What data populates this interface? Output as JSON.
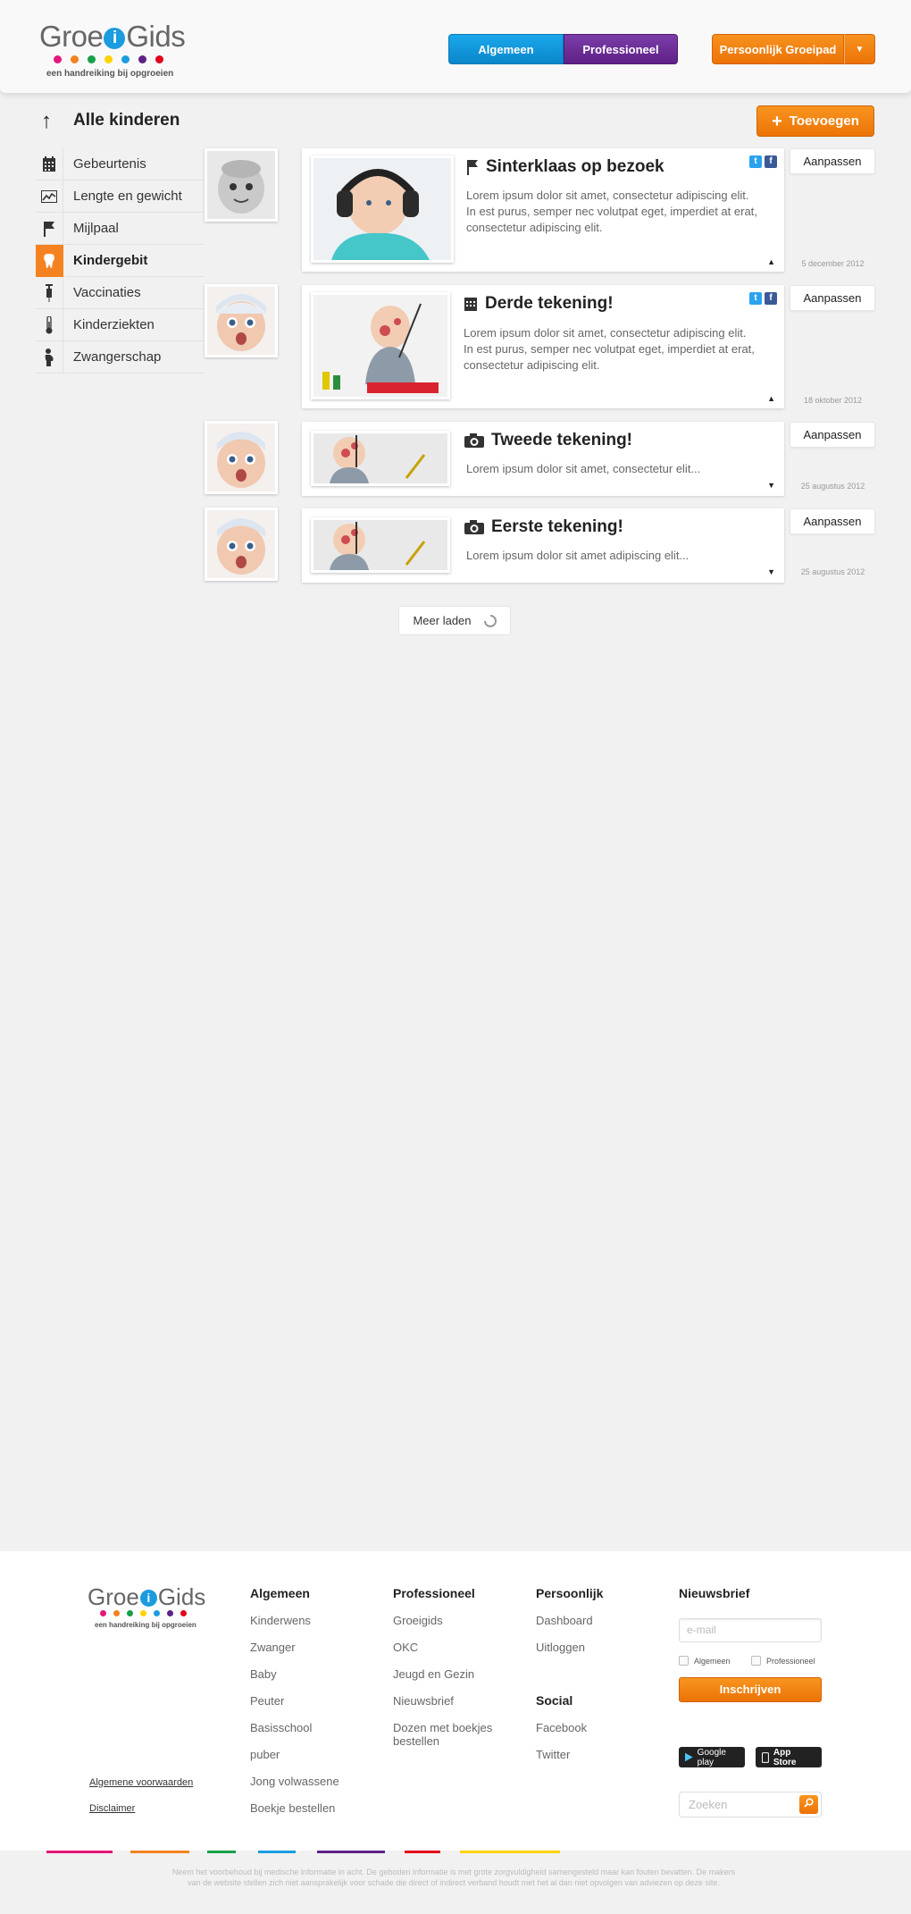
{
  "brand": {
    "name_left": "Groe",
    "name_i": "i",
    "name_right": "Gids",
    "tagline": "een handreiking bij opgroeien",
    "dot_colors": [
      "#e5177b",
      "#f58220",
      "#17a048",
      "#ffd200",
      "#1b9ce0",
      "#5e2186",
      "#e3001b"
    ]
  },
  "header": {
    "nav_algemeen": "Algemeen",
    "nav_professioneel": "Professioneel",
    "nav_persoonlijk": "Persoonlijk Groeipad",
    "nav_dropdown_glyph": "▼"
  },
  "page": {
    "back_glyph": "↑",
    "title": "Alle kinderen",
    "add_plus": "+",
    "add_label": "Toevoegen"
  },
  "menu": {
    "items": [
      {
        "label": "Gebeurtenis",
        "icon": "calendar-icon"
      },
      {
        "label": "Lengte en gewicht",
        "icon": "chart-icon"
      },
      {
        "label": "Mijlpaal",
        "icon": "flag-icon"
      },
      {
        "label": "Kindergebit",
        "icon": "tooth-icon",
        "active": true
      },
      {
        "label": "Vaccinaties",
        "icon": "syringe-icon"
      },
      {
        "label": "Kinderziekten",
        "icon": "thermometer-icon"
      },
      {
        "label": "Zwangerschap",
        "icon": "pregnancy-icon"
      }
    ]
  },
  "timeline": {
    "edit_label": "Aanpassen",
    "twitter_glyph": "t",
    "facebook_glyph": "f",
    "expanded_glyph": "▲",
    "collapsed_glyph": "▼",
    "entries": [
      {
        "title": "Sinterklaas op bezoek",
        "icon": "flag-icon",
        "text": "Lorem ipsum dolor sit amet, consectetur adipiscing elit. In est purus, semper nec volutpat eget, imperdiet at erat, consectetur adipiscing elit.",
        "date": "5 december 2012",
        "expanded": true
      },
      {
        "title": "Derde tekening!",
        "icon": "calendar-icon",
        "text": "Lorem ipsum dolor sit amet, consectetur adipiscing elit. In est purus, semper nec volutpat eget, imperdiet at erat, consectetur adipiscing elit.",
        "date": "18 oktober 2012",
        "expanded": true
      },
      {
        "title": "Tweede tekening!",
        "icon": "camera-icon",
        "text": "Lorem ipsum dolor sit amet, consectetur elit...",
        "date": "25 augustus 2012",
        "expanded": false
      },
      {
        "title": "Eerste tekening!",
        "icon": "camera-icon",
        "text": "Lorem ipsum dolor sit amet adipiscing elit...",
        "date": "25 augustus 2012",
        "expanded": false
      }
    ],
    "load_more": "Meer laden"
  },
  "footer": {
    "legal": [
      "Algemene voorwaarden",
      "Disclaimer"
    ],
    "algemeen": {
      "title": "Algemeen",
      "links": [
        "Kinderwens",
        "Zwanger",
        "Baby",
        "Peuter",
        "Basisschool",
        "puber",
        "Jong volwassene",
        "Boekje bestellen"
      ]
    },
    "professioneel": {
      "title": "Professioneel",
      "links": [
        "Groeigids",
        "OKC",
        "Jeugd en Gezin",
        "Nieuwsbrief",
        "Dozen met boekjes bestellen"
      ]
    },
    "persoonlijk": {
      "title": "Persoonlijk",
      "links": [
        "Dashboard",
        "Uitloggen"
      ]
    },
    "social": {
      "title": "Social",
      "links": [
        "Facebook",
        "Twitter"
      ]
    },
    "newsletter": {
      "title": "Nieuwsbrief",
      "email_placeholder": "e-mail",
      "opt_algemeen": "Algemeen",
      "opt_professioneel": "Professioneel",
      "subscribe": "Inschrijven"
    },
    "stores": {
      "google": "Google play",
      "apple": "App Store"
    },
    "search_placeholder": "Zoeken",
    "bar_colors": [
      "#e5177b",
      "#f58220",
      "#17a048",
      "#1b9ce0",
      "#5e2186",
      "#e3001b",
      "#ffd200"
    ],
    "disclaimer": "Neem het voorbehoud bij medische informatie in acht. De geboden informatie is met grote zorgvuldigheid samengesteld maar kan fouten bevatten. De makers van de website stellen zich niet aansprakelijk voor schade die direct of indirect verband houdt met het al dan niet opvolgen van adviezen op deze site."
  }
}
